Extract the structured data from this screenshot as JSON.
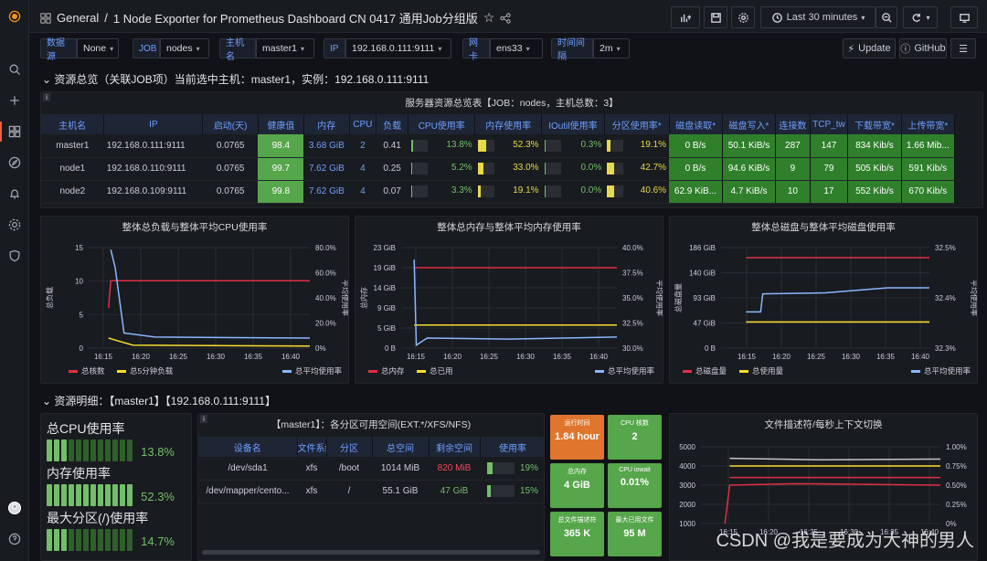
{
  "breadcrumb": {
    "folder": "General",
    "sep": "/",
    "title": "1 Node Exporter for Prometheus Dashboard CN 0417 通用Job分组版"
  },
  "topbar": {
    "time_range": "Last 30 minutes"
  },
  "variables": [
    {
      "label": "数据源",
      "value": "None"
    },
    {
      "label": "JOB",
      "value": "nodes"
    },
    {
      "label": "主机名",
      "value": "master1"
    },
    {
      "label": "IP",
      "value": "192.168.0.111:9111"
    },
    {
      "label": "网卡",
      "value": "ens33"
    },
    {
      "label": "时间间隔",
      "value": "2m"
    }
  ],
  "links": {
    "update": "Update",
    "github": "GitHub"
  },
  "row1": {
    "title": "资源总览（关联JOB项）当前选中主机：master1，实例：192.168.0.111:9111"
  },
  "server_table": {
    "title": "服务器资源总览表【JOB：nodes，主机总数：3】",
    "headers": [
      "主机名",
      "IP",
      "启动(天)",
      "健康值",
      "内存",
      "CPU",
      "负载",
      "CPU使用率",
      "内存使用率",
      "IOutil使用率",
      "分区使用率*",
      "磁盘读取*",
      "磁盘写入*",
      "连接数",
      "TCP_tw",
      "下载带宽*",
      "上传带宽*"
    ],
    "rows": [
      {
        "host": "master1",
        "ip": "192.168.0.111:9111",
        "uptime": "0.0765",
        "health": "98.4",
        "mem": "3.68 GiB",
        "cpu": "2",
        "load": "0.41",
        "cpu_pct": "13.8%",
        "mem_pct": "52.3%",
        "io_pct": "0.3%",
        "part_pct": "19.1%",
        "disk_r": "0 B/s",
        "disk_w": "50.1 KiB/s",
        "conn": "287",
        "tcptw": "147",
        "down": "834 Kib/s",
        "up": "1.66 Mib..."
      },
      {
        "host": "node1",
        "ip": "192.168.0.110:9111",
        "uptime": "0.0765",
        "health": "99.7",
        "mem": "7.62 GiB",
        "cpu": "4",
        "load": "0.25",
        "cpu_pct": "5.2%",
        "mem_pct": "33.0%",
        "io_pct": "0.0%",
        "part_pct": "42.7%",
        "disk_r": "0 B/s",
        "disk_w": "94.6 KiB/s",
        "conn": "9",
        "tcptw": "79",
        "down": "505 Kib/s",
        "up": "591 Kib/s"
      },
      {
        "host": "node2",
        "ip": "192.168.0.109:9111",
        "uptime": "0.0765",
        "health": "99.8",
        "mem": "7.62 GiB",
        "cpu": "4",
        "load": "0.07",
        "cpu_pct": "3.3%",
        "mem_pct": "19.1%",
        "io_pct": "0.0%",
        "part_pct": "40.6%",
        "disk_r": "62.9 KiB...",
        "disk_w": "4.7 KiB/s",
        "conn": "10",
        "tcptw": "17",
        "down": "552 Kib/s",
        "up": "670 Kib/s"
      }
    ],
    "gauge_fractions": [
      [
        0.14,
        0.52,
        0.01,
        0.19
      ],
      [
        0.05,
        0.33,
        0.0,
        0.43
      ],
      [
        0.03,
        0.19,
        0.0,
        0.41
      ]
    ]
  },
  "chart_data": [
    {
      "type": "line",
      "title": "整体总负载与整体平均CPU使用率",
      "ylabel": "总负载",
      "y2label": "平均使用率",
      "x": [
        "16:15",
        "16:20",
        "16:25",
        "16:30",
        "16:35",
        "16:40"
      ],
      "yticks": [
        "0",
        "5",
        "10",
        "15"
      ],
      "y2ticks": [
        "0%",
        "20.0%",
        "40.0%",
        "60.0%",
        "80.0%"
      ],
      "series": [
        {
          "name": "总核数",
          "color": "#e02f44"
        },
        {
          "name": "总5分钟负载",
          "color": "#fade2a"
        },
        {
          "name": "总平均使用率",
          "color": "#8ab8ff"
        }
      ]
    },
    {
      "type": "line",
      "title": "整体总内存与整体平均内存使用率",
      "ylabel": "总内存",
      "y2label": "平均使用率",
      "x": [
        "16:15",
        "16:20",
        "16:25",
        "16:30",
        "16:35",
        "16:40"
      ],
      "yticks": [
        "0 B",
        "5 GiB",
        "9 GiB",
        "14 GiB",
        "19 GiB",
        "23 GiB"
      ],
      "y2ticks": [
        "30.0%",
        "32.5%",
        "35.0%",
        "37.5%",
        "40.0%"
      ],
      "series": [
        {
          "name": "总内存",
          "color": "#e02f44"
        },
        {
          "name": "总已用",
          "color": "#fade2a"
        },
        {
          "name": "总平均使用率",
          "color": "#8ab8ff"
        }
      ]
    },
    {
      "type": "line",
      "title": "整体总磁盘与整体平均磁盘使用率",
      "ylabel": "总磁盘量",
      "y2label": "平均使用率",
      "x": [
        "16:15",
        "16:20",
        "16:25",
        "16:30",
        "16:35",
        "16:40"
      ],
      "yticks": [
        "0 B",
        "47 GiB",
        "93 GiB",
        "140 GiB",
        "186 GiB"
      ],
      "y2ticks": [
        "32.3%",
        "32.4%",
        "32.5%"
      ],
      "series": [
        {
          "name": "总磁盘量",
          "color": "#e02f44"
        },
        {
          "name": "总使用量",
          "color": "#fade2a"
        },
        {
          "name": "总平均使用率",
          "color": "#8ab8ff"
        }
      ]
    },
    {
      "type": "line",
      "title": "文件描述符/每秒上下文切换",
      "x": [
        "16:15",
        "16:20",
        "16:25",
        "16:30",
        "16:35",
        "16:40"
      ],
      "yticks": [
        "1000",
        "2000",
        "3000",
        "4000",
        "5000"
      ],
      "y2ticks": [
        "0%",
        "0.25%",
        "0.50%",
        "0.75%",
        "1.00%"
      ]
    }
  ],
  "row2": {
    "title": "资源明细：【master1】【192.168.0.111:9111】"
  },
  "bars": [
    {
      "label": "总CPU使用率",
      "value": "13.8%"
    },
    {
      "label": "内存使用率",
      "value": "52.3%"
    },
    {
      "label": "最大分区(/)使用率",
      "value": "14.7%"
    }
  ],
  "part_table": {
    "title": "【master1】：各分区可用空间(EXT.*/XFS/NFS)",
    "headers": [
      "设备名",
      "文件系统",
      "分区",
      "总空间",
      "剩余空间",
      "使用率"
    ],
    "rows": [
      {
        "dev": "/dev/sda1",
        "fs": "xfs",
        "mnt": "/boot",
        "total": "1014 MiB",
        "free": "820 MiB",
        "pct": "19%"
      },
      {
        "dev": "/dev/mapper/cento...",
        "fs": "xfs",
        "mnt": "/",
        "total": "55.1 GiB",
        "free": "47 GiB",
        "pct": "15%"
      }
    ]
  },
  "tiles": [
    {
      "t": "运行时间",
      "v": "1.84 hour",
      "c": "#e0752d"
    },
    {
      "t": "CPU 核数",
      "v": "2",
      "c": "#56a64b"
    },
    {
      "t": "总内存",
      "v": "4 GiB",
      "c": "#56a64b"
    },
    {
      "t": "CPU iowait",
      "v": "0.01%",
      "c": "#56a64b"
    },
    {
      "t": "总文件描述符",
      "v": "365 K",
      "c": "#56a64b"
    },
    {
      "t": "最大已用文件",
      "v": "95 M",
      "c": "#56a64b"
    }
  ],
  "watermark": "CSDN @我是要成为大神的男人",
  "colors": {
    "accent": "#f55f3e",
    "green": "#73bf69",
    "yellow": "#e8d84b",
    "blue": "#6e9fff"
  }
}
